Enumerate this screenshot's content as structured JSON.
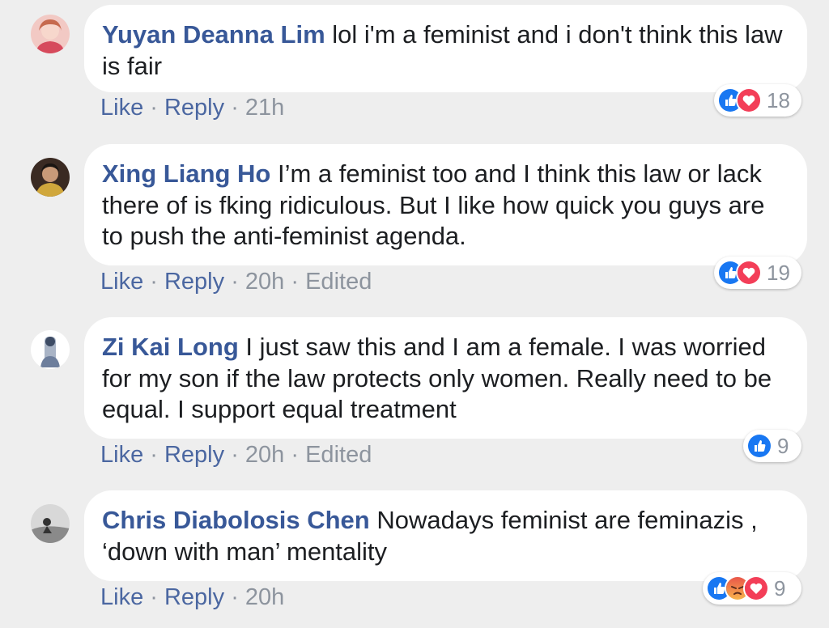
{
  "comments": [
    {
      "author": "Yuyan Deanna Lim",
      "text": "lol i'm a feminist and i don't think this law is fair",
      "actions": {
        "like": "Like",
        "reply": "Reply",
        "time": "21h",
        "edited": ""
      },
      "reactions": {
        "icons": [
          "like-icon",
          "love-icon"
        ],
        "count": "18"
      }
    },
    {
      "author": "Xing Liang Ho",
      "text": "I’m a feminist too and I think this law or lack there of is fking ridiculous. But I like how quick you guys are to push the anti-feminist agenda.",
      "actions": {
        "like": "Like",
        "reply": "Reply",
        "time": "20h",
        "edited": "Edited"
      },
      "reactions": {
        "icons": [
          "like-icon",
          "love-icon"
        ],
        "count": "19"
      }
    },
    {
      "author": "Zi Kai Long",
      "text": "I just saw this and I am a female. I was worried for my son if the law protects only women. Really need to be equal. I support equal treatment",
      "actions": {
        "like": "Like",
        "reply": "Reply",
        "time": "20h",
        "edited": "Edited"
      },
      "reactions": {
        "icons": [
          "like-icon"
        ],
        "count": "9"
      }
    },
    {
      "author": "Chris Diabolosis Chen",
      "text": "Nowadays feminist are feminazis , ‘down with man’ mentality",
      "actions": {
        "like": "Like",
        "reply": "Reply",
        "time": "20h",
        "edited": ""
      },
      "reactions": {
        "icons": [
          "like-icon",
          "angry-icon",
          "love-icon"
        ],
        "count": "9"
      }
    }
  ],
  "colors": {
    "author": "#385898",
    "like_blue": "#1877f2",
    "love_red": "#f33e58",
    "angry_orange": "#f7714c",
    "meta_grey": "#8d949e"
  },
  "separator": "·"
}
